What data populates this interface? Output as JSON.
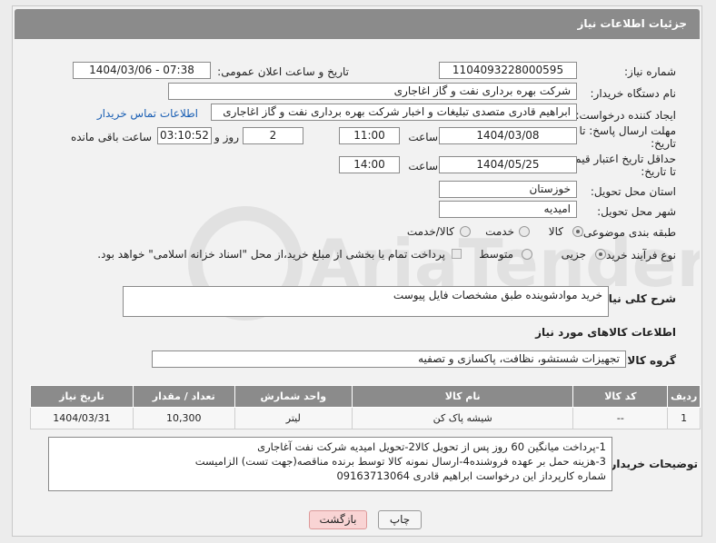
{
  "header": {
    "title": "جزئیات اطلاعات نیاز"
  },
  "form": {
    "need_number_label": "شماره نیاز:",
    "need_number": "1104093228000595",
    "announce_label": "تاریخ و ساعت اعلان عمومی:",
    "announce_value": "1404/03/06 - 07:38",
    "buyer_org_label": "نام دستگاه خریدار:",
    "buyer_org": "شرکت بهره برداری نفت و گاز اغاجاری",
    "creator_label": "ایجاد کننده درخواست:",
    "creator": "ابراهیم قادری متصدی تبلیغات و اخبار شرکت بهره برداری نفت و گاز اغاجاری",
    "contact_link": "اطلاعات تماس خریدار",
    "deadline_label_1": "مهلت ارسال پاسخ: تا",
    "deadline_label_2": "تاریخ:",
    "deadline_date": "1404/03/08",
    "time_label": "ساعت",
    "deadline_time": "11:00",
    "days_value": "2",
    "days_label": "روز و",
    "remaining_value": "03:10:52",
    "remaining_label": "ساعت باقی مانده",
    "validity_label_1": "حداقل تاریخ اعتبار قیمت:",
    "validity_label_2": "تا تاریخ:",
    "validity_date": "1404/05/25",
    "validity_time_label": "ساعت",
    "validity_time": "14:00",
    "province_label": "استان محل تحویل:",
    "province": "خوزستان",
    "city_label": "شهر محل تحویل:",
    "city": "امیدیه",
    "category_label": "طبقه بندی موضوعی:",
    "category_options": [
      "کالا",
      "خدمت",
      "کالا/خدمت"
    ],
    "process_label": "نوع فرآیند خرید :",
    "process_options": [
      "جزیی",
      "متوسط"
    ],
    "process_note": "پرداخت تمام یا بخشی از مبلغ خرید،از محل \"اسناد خزانه اسلامی\" خواهد بود."
  },
  "description": {
    "label": "شرح کلی نیاز:",
    "value": "خرید موادشوینده طبق مشخصات فایل پیوست"
  },
  "goods_section_title": "اطلاعات کالاهای مورد نیاز",
  "goods_group": {
    "label": "گروه کالا:",
    "value": "تجهیزات شستشو، نظافت، پاکسازی و تصفیه"
  },
  "table": {
    "headers": [
      "ردیف",
      "کد کالا",
      "نام کالا",
      "واحد شمارش",
      "تعداد / مقدار",
      "تاریخ نیاز"
    ],
    "rows": [
      [
        "1",
        "--",
        "شیشه پاک کن",
        "لیتر",
        "10,300",
        "1404/03/31"
      ]
    ]
  },
  "buyer_notes": {
    "label": "توضیحات خریدار:",
    "lines": [
      "1-پرداخت میانگین 60 روز پس از تحویل کالا2-تحویل امیدیه شرکت نفت آغاجاری",
      "3-هزینه حمل بر عهده فروشنده4-ارسال نمونه کالا توسط برنده مناقصه(جهت تست) الزامیست",
      "شماره کارپرداز این درخواست  ابراهیم قادری 09163713064"
    ]
  },
  "buttons": {
    "print": "چاپ",
    "back": "بازگشت"
  },
  "watermark": "AriaTender.net"
}
